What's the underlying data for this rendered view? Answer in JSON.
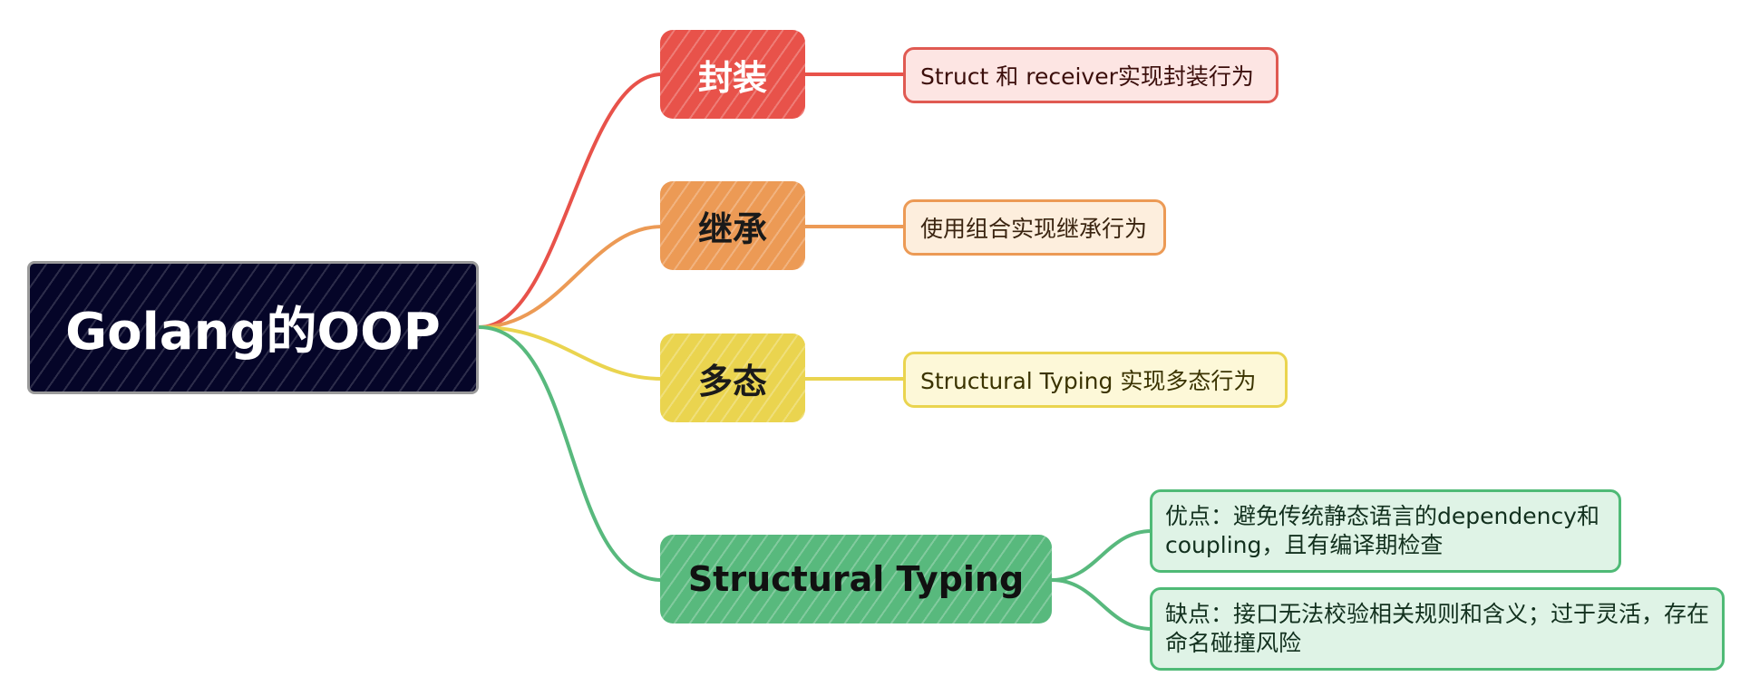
{
  "root": {
    "label": "Golang的OOP"
  },
  "branches": [
    {
      "label": "封装",
      "color": "#e8524a",
      "children": [
        "Struct 和 receiver实现封装行为"
      ]
    },
    {
      "label": "继承",
      "color": "#ec9a55",
      "children": [
        "使用组合实现继承行为"
      ]
    },
    {
      "label": "多态",
      "color": "#ead44f",
      "children": [
        "Structural Typing 实现多态行为"
      ]
    },
    {
      "label": "Structural Typing",
      "color": "#58b97d",
      "children": [
        "优点：避免传统静态语言的dependency和coupling，且有编译期检查",
        "缺点：接口无法校验相关规则和含义；过于灵活，存在命名碰撞风险"
      ]
    }
  ],
  "colors": {
    "root_bg": "#050528",
    "root_border": "#9a9a9a"
  }
}
